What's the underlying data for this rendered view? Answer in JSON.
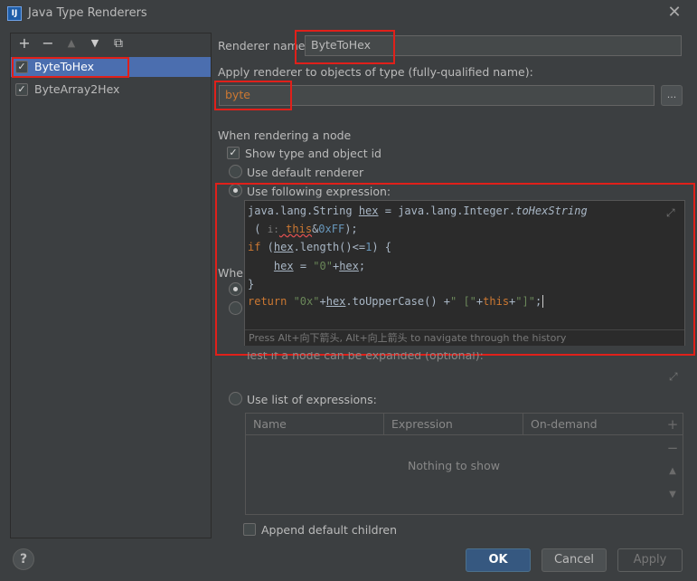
{
  "window": {
    "title": "Java Type Renderers"
  },
  "toolbar": {
    "add": "+",
    "remove": "−",
    "up": "▲",
    "down": "▼",
    "copy": "⧉"
  },
  "renderers": [
    {
      "label": "ByteToHex",
      "checked": true,
      "selected": true
    },
    {
      "label": "ByteArray2Hex",
      "checked": true,
      "selected": false
    }
  ],
  "form": {
    "renderer_name_label": "Renderer name:",
    "renderer_name_value": "ByteToHex",
    "apply_type_label": "Apply renderer to objects of type (fully-qualified name):",
    "apply_type_value": "byte",
    "browse_label": "...",
    "when_rendering_label": "When rendering a node",
    "show_type_label": "Show type and object id",
    "use_default_label": "Use default renderer",
    "use_expression_label": "Use following expression:",
    "when_expanding_partial": "Whe",
    "test_expandable_label": "Test if a node can be expanded (optional):",
    "use_list_label": "Use list of expressions:",
    "append_default_label": "Append default children"
  },
  "editor": {
    "line1_a": "java.lang.String ",
    "line1_var": "hex",
    "line1_b": " = java.lang.Integer.",
    "line1_method": "toHexString",
    "line2_a": " ( ",
    "line2_hint": "i:",
    "line2_this": " this",
    "line2_amp": "&",
    "line2_num": "0xFF",
    "line2_end": ");",
    "line3_kw": "if",
    "line3_a": " (",
    "line3_var": "hex",
    "line3_b": ".length()<=",
    "line3_num": "1",
    "line3_c": ") {",
    "line4_pad": "    ",
    "line4_var": "hex",
    "line4_a": " = ",
    "line4_str": "\"0\"",
    "line4_b": "+",
    "line4_var2": "hex",
    "line4_c": ";",
    "line5": "}",
    "line6_kw": "return",
    "line6_str1": " \"0x\"",
    "line6_a": "+",
    "line6_var": "hex",
    "line6_b": ".toUpperCase() +",
    "line6_str2": "\" [\"",
    "line6_c": "+",
    "line6_this": "this",
    "line6_d": "+",
    "line6_str3": "\"]\"",
    "line6_e": ";",
    "history_hint": "Press Alt+向下箭头, Alt+向上箭头 to navigate through the history"
  },
  "table": {
    "columns": [
      "Name",
      "Expression",
      "On-demand"
    ],
    "empty_text": "Nothing to show"
  },
  "buttons": {
    "help": "?",
    "ok": "OK",
    "cancel": "Cancel",
    "apply": "Apply"
  },
  "side_buttons": {
    "add": "+",
    "remove": "−",
    "up": "▲",
    "down": "▼"
  },
  "colors": {
    "background": "#3c3f41",
    "selection": "#4b6eaf",
    "highlight": "#e0201a",
    "primary_button": "#365880"
  }
}
